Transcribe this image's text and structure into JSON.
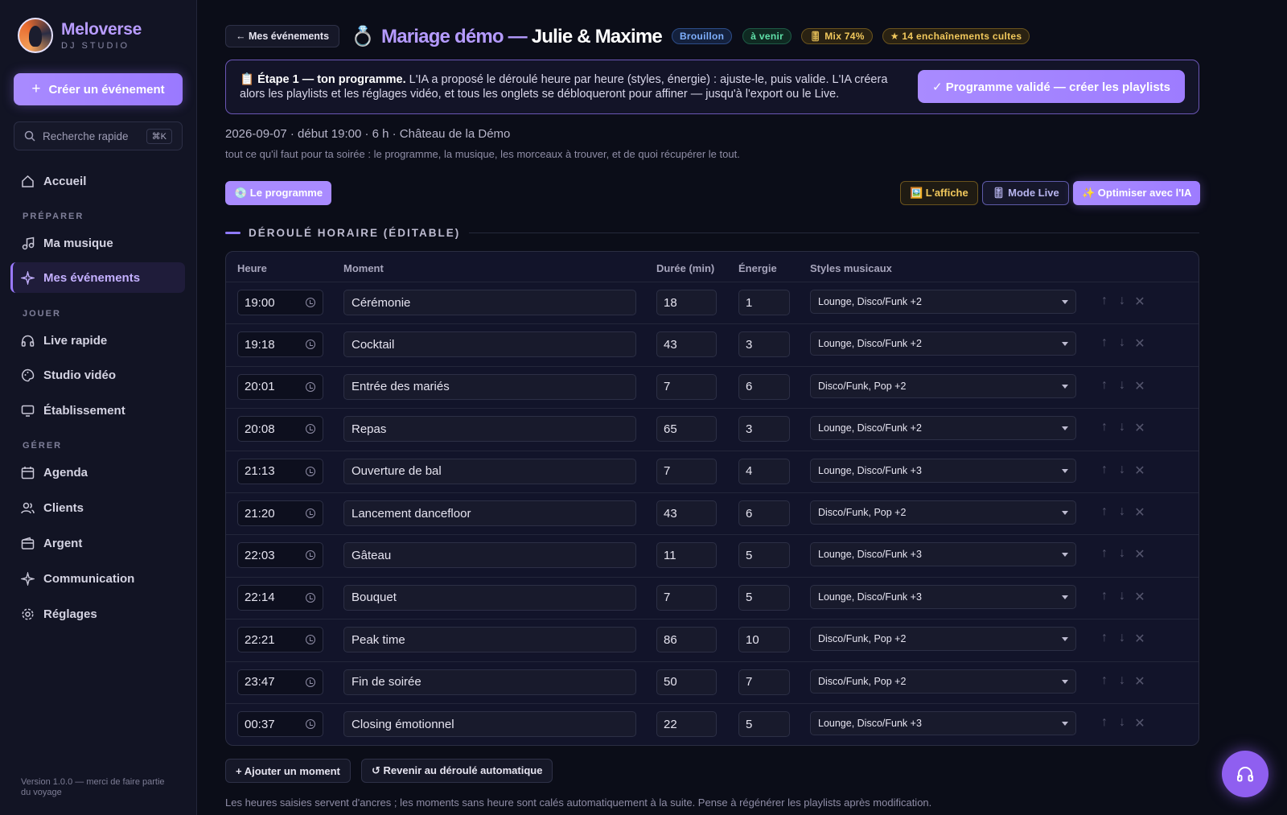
{
  "brand": {
    "name": "Meloverse",
    "subtitle": "DJ STUDIO"
  },
  "sidebar": {
    "create_label": "Créer un événement",
    "search_label": "Recherche rapide",
    "search_shortcut": "⌘K",
    "home": "Accueil",
    "sections": {
      "prepare": "PRÉPARER",
      "play": "JOUER",
      "manage": "GÉRER"
    },
    "items": {
      "music": "Ma musique",
      "events": "Mes événements",
      "live": "Live rapide",
      "video": "Studio vidéo",
      "venue": "Établissement",
      "agenda": "Agenda",
      "clients": "Clients",
      "money": "Argent",
      "communication": "Communication",
      "settings": "Réglages"
    },
    "version": "Version 1.0.0 — merci de faire partie du voyage"
  },
  "header": {
    "back_label": "← Mes événements",
    "ring_icon": "💍",
    "title_part1": "Mariage démo —",
    "title_part2": "Julie & Maxime",
    "badges": {
      "draft": "Brouillon",
      "upcoming": "à venir",
      "mix": "🎚 Mix 74%",
      "cult": "★ 14 enchaînements cultes"
    }
  },
  "step": {
    "icon": "📋",
    "bold": "Étape 1 — ton programme.",
    "text": " L'IA a proposé le déroulé heure par heure (styles, énergie) : ajuste-le, puis valide. L'IA créera alors les playlists et les réglages vidéo, et tous les onglets se débloqueront pour affiner — jusqu'à l'export ou le Live.",
    "validate_label": "✓ Programme validé — créer les playlists"
  },
  "event": {
    "meta": "2026-09-07 · début 19:00 · 6 h · Château de la Démo",
    "description": "tout ce qu'il faut pour ta soirée : le programme, la musique, les morceaux à trouver, et de quoi récupérer le tout."
  },
  "toolbar": {
    "program_tab": "💿 Le programme",
    "poster": "🖼️ L'affiche",
    "live_mode": "🎚 Mode Live",
    "optimize": "✨ Optimiser avec l'IA"
  },
  "schedule": {
    "section_title": "DÉROULÉ HORAIRE (ÉDITABLE)",
    "columns": {
      "time": "Heure",
      "moment": "Moment",
      "duration": "Durée (min)",
      "energy": "Énergie",
      "styles": "Styles musicaux"
    },
    "rows": [
      {
        "time": "19:00",
        "moment": "Cérémonie",
        "duration": "18",
        "energy": "1",
        "styles": "Lounge, Disco/Funk +2"
      },
      {
        "time": "19:18",
        "moment": "Cocktail",
        "duration": "43",
        "energy": "3",
        "styles": "Lounge, Disco/Funk +2"
      },
      {
        "time": "20:01",
        "moment": "Entrée des mariés",
        "duration": "7",
        "energy": "6",
        "styles": "Disco/Funk, Pop +2"
      },
      {
        "time": "20:08",
        "moment": "Repas",
        "duration": "65",
        "energy": "3",
        "styles": "Lounge, Disco/Funk +2"
      },
      {
        "time": "21:13",
        "moment": "Ouverture de bal",
        "duration": "7",
        "energy": "4",
        "styles": "Lounge, Disco/Funk +3"
      },
      {
        "time": "21:20",
        "moment": "Lancement dancefloor",
        "duration": "43",
        "energy": "6",
        "styles": "Disco/Funk, Pop +2"
      },
      {
        "time": "22:03",
        "moment": "Gâteau",
        "duration": "11",
        "energy": "5",
        "styles": "Lounge, Disco/Funk +3"
      },
      {
        "time": "22:14",
        "moment": "Bouquet",
        "duration": "7",
        "energy": "5",
        "styles": "Lounge, Disco/Funk +3"
      },
      {
        "time": "22:21",
        "moment": "Peak time",
        "duration": "86",
        "energy": "10",
        "styles": "Disco/Funk, Pop +2"
      },
      {
        "time": "23:47",
        "moment": "Fin de soirée",
        "duration": "50",
        "energy": "7",
        "styles": "Disco/Funk, Pop +2"
      },
      {
        "time": "00:37",
        "moment": "Closing émotionnel",
        "duration": "22",
        "energy": "5",
        "styles": "Lounge, Disco/Funk +3"
      }
    ],
    "row_actions": {
      "up": "↑",
      "down": "↓",
      "remove": "✕"
    },
    "add_label": "+ Ajouter un moment",
    "revert_label": "↺ Revenir au déroulé automatique",
    "footnote": "Les heures saisies servent d'ancres ; les moments sans heure sont calés automatiquement à la suite. Pense à régénérer les playlists après modification."
  },
  "colors": {
    "accent": "#a98bff",
    "background": "#0b0d18",
    "sidebar": "#121424"
  }
}
